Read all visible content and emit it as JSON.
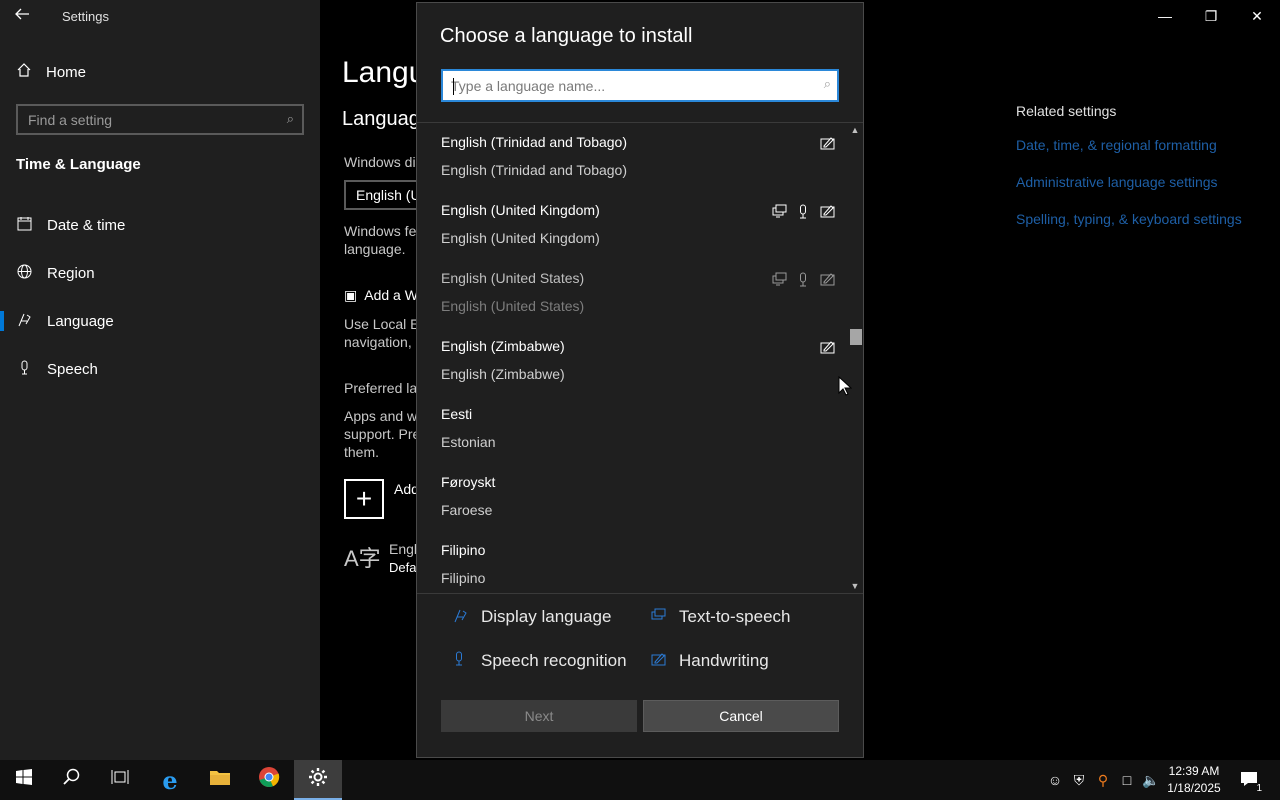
{
  "window": {
    "title": "Settings",
    "controls": {
      "minimize": "—",
      "restore": "❐",
      "close": "✕"
    }
  },
  "nav": {
    "home": "Home",
    "search_placeholder": "Find a setting",
    "section": "Time & Language",
    "items": [
      {
        "label": "Date & time",
        "icon": "calendar-icon"
      },
      {
        "label": "Region",
        "icon": "globe-icon"
      },
      {
        "label": "Language",
        "icon": "language-icon"
      },
      {
        "label": "Speech",
        "icon": "microphone-icon"
      }
    ]
  },
  "main": {
    "title": "Langu",
    "subtitle": "Languag",
    "windows_display": "Windows di",
    "display_select": "English (U",
    "windows_features": [
      "Windows fe",
      "language."
    ],
    "add_windows": "Add a W",
    "use_local": [
      "Use Local Ex",
      "navigation,"
    ],
    "preferred": "Preferred la",
    "apps": [
      "Apps and w",
      "support. Pre",
      "them."
    ],
    "add_language": "Add",
    "english": "Engl",
    "english_default": "Defa"
  },
  "related": {
    "heading": "Related settings",
    "links": [
      "Date, time, & regional formatting",
      "Administrative language settings",
      "Spelling, typing, & keyboard settings"
    ]
  },
  "dialog": {
    "title": "Choose a language to install",
    "search_placeholder": "Type a language name...",
    "languages": [
      {
        "native": "English (Trinidad and Tobago)",
        "english": "English (Trinidad and Tobago)",
        "features": [
          "handwriting"
        ],
        "dim": false
      },
      {
        "native": "English (United Kingdom)",
        "english": "English (United Kingdom)",
        "features": [
          "text-to-speech",
          "speech",
          "handwriting"
        ],
        "dim": false
      },
      {
        "native": "English (United States)",
        "english": "English (United States)",
        "features": [
          "text-to-speech",
          "speech",
          "handwriting"
        ],
        "dim": true
      },
      {
        "native": "English (Zimbabwe)",
        "english": "English (Zimbabwe)",
        "features": [
          "handwriting"
        ],
        "dim": false
      },
      {
        "native": "Eesti",
        "english": "Estonian",
        "features": [],
        "dim": false
      },
      {
        "native": "Føroyskt",
        "english": "Faroese",
        "features": [],
        "dim": false
      },
      {
        "native": "Filipino",
        "english": "Filipino",
        "features": [],
        "dim": false
      }
    ],
    "legend": {
      "display_language": "Display language",
      "text_to_speech": "Text-to-speech",
      "speech_recognition": "Speech recognition",
      "handwriting": "Handwriting"
    },
    "next_label": "Next",
    "cancel_label": "Cancel"
  },
  "taskbar": {
    "time": "12:39 AM",
    "date": "1/18/2025",
    "notification_count": "1"
  },
  "colors": {
    "accent": "#0078d7",
    "link": "#2b7bd6"
  }
}
